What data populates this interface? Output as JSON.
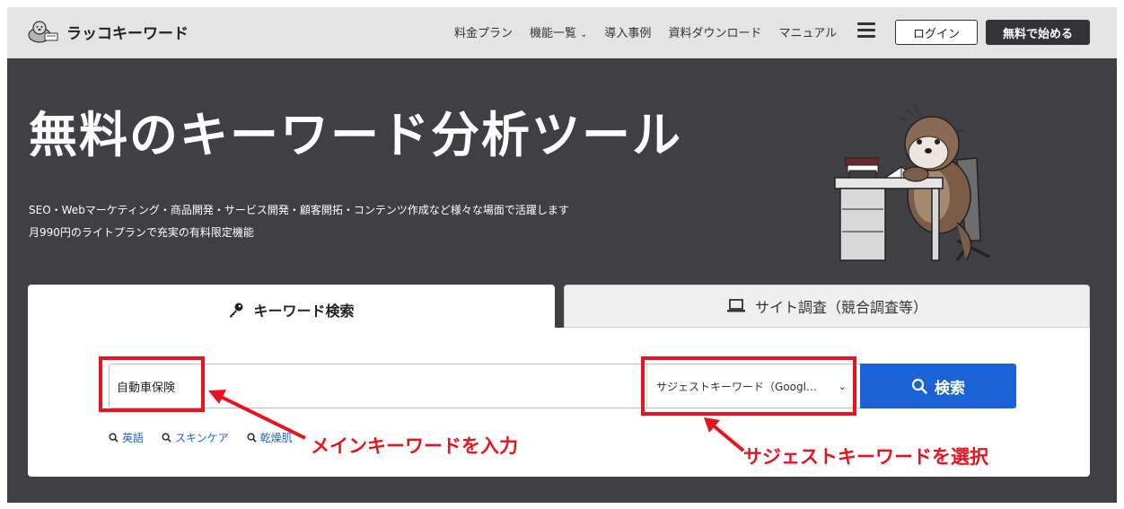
{
  "brand": {
    "name": "ラッコキーワード"
  },
  "nav": {
    "links": [
      "料金プラン",
      "機能一覧",
      "導入事例",
      "資料ダウンロード",
      "マニュアル"
    ],
    "menu_icon": "hamburger-icon",
    "login_label": "ログイン",
    "start_label": "無料で始める"
  },
  "hero": {
    "title": "無料のキーワード分析ツール",
    "subtitle_1": "SEO・Webマーケティング・商品開発・サービス開発・顧客開拓・コンテンツ作成など様々な場面で活躍します",
    "subtitle_2": "月990円のライトプランで充実の有料限定機能"
  },
  "tabs": {
    "keyword": {
      "label": "キーワード検索",
      "icon": "key-icon",
      "active": true
    },
    "site": {
      "label": "サイト調査（競合調査等）",
      "icon": "laptop-icon",
      "active": false
    }
  },
  "search": {
    "keyword_value": "自動車保険",
    "mode_selected": "サジェストキーワード（Googl…",
    "button_label": "検索"
  },
  "hints": [
    "英語",
    "スキンケア",
    "乾燥肌"
  ],
  "annotations": {
    "input_note": "メインキーワードを入力",
    "select_note": "サジェストキーワードを選択"
  },
  "colors": {
    "accent": "#1b62d6",
    "annotation": "#e8131d",
    "hero_bg": "#3f3f44",
    "nav_bg": "#e4e4e4"
  }
}
